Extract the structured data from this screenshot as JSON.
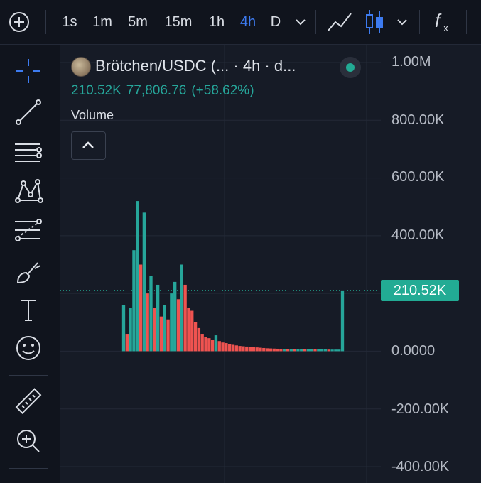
{
  "toolbar": {
    "add_icon": "plus-circle-icon",
    "intervals": [
      "1s",
      "1m",
      "5m",
      "15m",
      "1h",
      "4h",
      "D"
    ],
    "active_interval": "4h",
    "interval_dropdown_icon": "chevron-down-icon",
    "chart_type_line_icon": "line-chart-icon",
    "chart_type_candles_icon": "candlestick-icon",
    "chart_type_dropdown_icon": "chevron-down-icon",
    "indicators_icon": "fx-icon",
    "accent_color": "#3d7bf0"
  },
  "left_tools": [
    "crosshair-icon",
    "trend-line-icon",
    "horizontal-lines-icon",
    "pattern-icon",
    "fib-icon",
    "brush-icon",
    "text-icon",
    "emoji-icon",
    "ruler-icon",
    "zoom-in-icon"
  ],
  "legend": {
    "title": "Brötchen/USDC (...  · 4h · d...",
    "value": "210.52K",
    "change_abs": "77,806.76",
    "change_pct": "(+58.62%)",
    "status_color": "#22ab94"
  },
  "pane": {
    "label": "Volume",
    "collapse_icon": "chevron-up-icon"
  },
  "price_axis": {
    "labels": [
      "1.00M",
      "800.00K",
      "600.00K",
      "400.00K",
      "0.0000",
      "-200.00K",
      "-400.00K"
    ],
    "current": "210.52K",
    "current_color": "#22ab94"
  },
  "chart_data": {
    "type": "line",
    "series_colors": {
      "up": "#26a69a",
      "down": "#ef5350"
    },
    "ylim": [
      -400000,
      1000000
    ],
    "x": [
      0,
      1,
      2,
      3,
      4,
      5,
      6,
      7,
      8,
      9,
      10,
      11,
      12,
      13,
      14,
      15,
      16,
      17,
      18,
      19,
      20,
      21,
      22,
      23,
      24,
      25,
      26,
      27,
      28,
      29,
      30,
      31,
      32,
      33,
      34,
      35,
      36,
      37,
      38,
      39,
      40,
      41,
      42,
      43,
      44,
      45,
      46,
      47,
      48,
      49,
      50,
      51,
      52,
      53,
      54,
      55,
      56,
      57,
      58,
      59,
      60,
      61,
      62,
      63,
      64
    ],
    "values": [
      160000,
      60000,
      150000,
      350000,
      520000,
      300000,
      480000,
      200000,
      260000,
      150000,
      230000,
      120000,
      160000,
      110000,
      200000,
      240000,
      180000,
      300000,
      230000,
      150000,
      140000,
      100000,
      80000,
      60000,
      50000,
      45000,
      40000,
      55000,
      35000,
      30000,
      28000,
      25000,
      22000,
      20000,
      18000,
      17000,
      16000,
      15000,
      14000,
      13000,
      12000,
      11000,
      10000,
      9500,
      9000,
      8500,
      8000,
      8000,
      7500,
      7500,
      7000,
      7000,
      7000,
      6500,
      6500,
      6500,
      6000,
      6000,
      6000,
      6000,
      5500,
      5500,
      5500,
      5500,
      210520
    ],
    "current_value": 210520
  }
}
